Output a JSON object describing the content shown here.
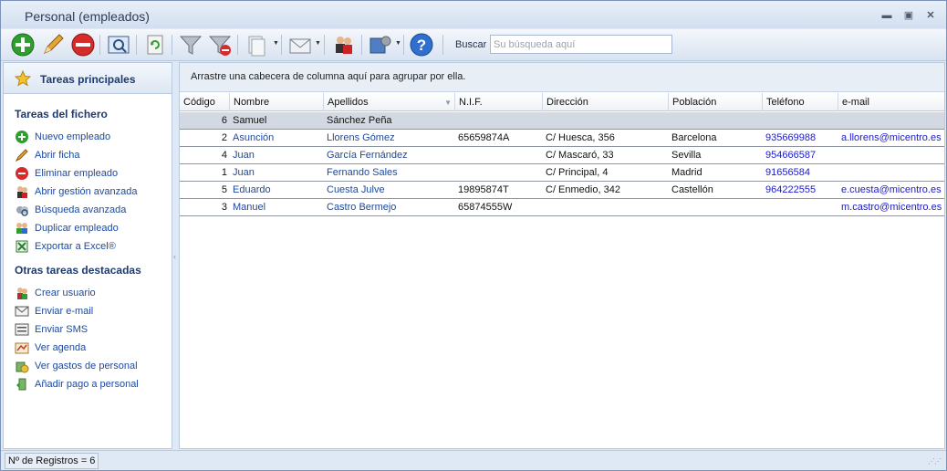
{
  "window": {
    "title": "Personal (empleados)"
  },
  "toolbar": {
    "search_label": "Buscar",
    "search_placeholder": "Su búsqueda aquí"
  },
  "sidebar": {
    "header": "Tareas principales",
    "section1": "Tareas del fichero",
    "items1": [
      "Nuevo empleado",
      "Abrir ficha",
      "Eliminar empleado",
      "Abrir gestión avanzada",
      "Búsqueda avanzada",
      "Duplicar empleado",
      "Exportar a Excel®"
    ],
    "section2": "Otras tareas destacadas",
    "items2": [
      "Crear usuario",
      "Enviar e-mail",
      "Enviar SMS",
      "Ver agenda",
      "Ver gastos de personal",
      "Añadir pago a personal"
    ]
  },
  "main": {
    "group_hint": "Arrastre una cabecera de columna aquí para agrupar por ella.",
    "columns": [
      "Código",
      "Nombre",
      "Apellidos",
      "N.I.F.",
      "Dirección",
      "Población",
      "Teléfono",
      "e-mail"
    ],
    "rows": [
      {
        "code": "6",
        "name": "Samuel",
        "surname": "Sánchez Peña",
        "nif": "",
        "address": "",
        "city": "",
        "phone": "",
        "email": ""
      },
      {
        "code": "2",
        "name": "Asunción",
        "surname": "Llorens Gómez",
        "nif": "65659874A",
        "address": "C/ Huesca, 356",
        "city": "Barcelona",
        "phone": "935669988",
        "email": "a.llorens@micentro.es"
      },
      {
        "code": "4",
        "name": "Juan",
        "surname": "García Fernández",
        "nif": "",
        "address": "C/ Mascaró, 33",
        "city": "Sevilla",
        "phone": "954666587",
        "email": ""
      },
      {
        "code": "1",
        "name": "Juan",
        "surname": "Fernando Sales",
        "nif": "",
        "address": "C/ Principal, 4",
        "city": "Madrid",
        "phone": "91656584",
        "email": ""
      },
      {
        "code": "5",
        "name": "Eduardo",
        "surname": "Cuesta Julve",
        "nif": "19895874T",
        "address": "C/ Enmedio, 342",
        "city": "Castellón",
        "phone": "964222555",
        "email": "e.cuesta@micentro.es"
      },
      {
        "code": "3",
        "name": "Manuel",
        "surname": "Castro Bermejo",
        "nif": "65874555W",
        "address": "",
        "city": "",
        "phone": "",
        "email": "m.castro@micentro.es"
      }
    ]
  },
  "status": {
    "text": "Nº de Registros = 6"
  }
}
